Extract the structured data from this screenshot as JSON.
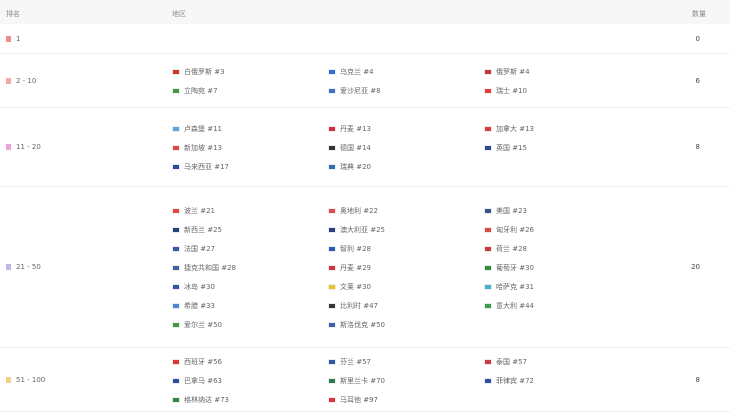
{
  "header": {
    "rank_label": "排名",
    "country_label": "地区",
    "count_label": "数量"
  },
  "groups": [
    {
      "range": "1",
      "color": "#f48b8b",
      "count": "0",
      "countries": []
    },
    {
      "range": "2 - 10",
      "color": "#f6a8a8",
      "count": "6",
      "countries": [
        {
          "name": "白俄罗斯 #3",
          "flag": "#d22f27"
        },
        {
          "name": "乌克兰 #4",
          "flag": "#2f6fd4"
        },
        {
          "name": "俄罗斯 #4",
          "flag": "#c8353d"
        },
        {
          "name": "立陶宛 #7",
          "flag": "#3a9b46"
        },
        {
          "name": "爱沙尼亚 #8",
          "flag": "#3b70c4"
        },
        {
          "name": "瑞士 #10",
          "flag": "#e23d3d"
        }
      ]
    },
    {
      "range": "11 - 20",
      "color": "#f2a2d8",
      "count": "8",
      "countries": [
        {
          "name": "卢森堡 #11",
          "flag": "#5ba4e0"
        },
        {
          "name": "丹麦 #13",
          "flag": "#d0313c"
        },
        {
          "name": "加拿大 #13",
          "flag": "#dc3b3b"
        },
        {
          "name": "新加坡 #13",
          "flag": "#e04848"
        },
        {
          "name": "德国 #14",
          "flag": "#333333"
        },
        {
          "name": "英国 #15",
          "flag": "#2e4a8c"
        },
        {
          "name": "马来西亚 #17",
          "flag": "#274c9e"
        },
        {
          "name": "瑞典 #20",
          "flag": "#2f6db5"
        }
      ]
    },
    {
      "range": "21 - 50",
      "color": "#c4b4ec",
      "count": "20",
      "countries": [
        {
          "name": "波兰 #21",
          "flag": "#e34848"
        },
        {
          "name": "奥地利 #22",
          "flag": "#e14a4a"
        },
        {
          "name": "美国 #23",
          "flag": "#3a4f8e"
        },
        {
          "name": "新西兰 #25",
          "flag": "#28407e"
        },
        {
          "name": "澳大利亚 #25",
          "flag": "#263f82"
        },
        {
          "name": "匈牙利 #26",
          "flag": "#d8493e"
        },
        {
          "name": "法国 #27",
          "flag": "#3459a8"
        },
        {
          "name": "智利 #28",
          "flag": "#2f57b5"
        },
        {
          "name": "荷兰 #28",
          "flag": "#c8383d"
        },
        {
          "name": "捷克共和国 #28",
          "flag": "#3b61a8"
        },
        {
          "name": "丹麦 #29",
          "flag": "#d0313c"
        },
        {
          "name": "葡萄牙 #30",
          "flag": "#2f8a3a"
        },
        {
          "name": "冰岛 #30",
          "flag": "#2c55a8"
        },
        {
          "name": "文莱 #30",
          "flag": "#e9c32d"
        },
        {
          "name": "哈萨克 #31",
          "flag": "#41b3c8"
        },
        {
          "name": "希腊 #33",
          "flag": "#4c86d0"
        },
        {
          "name": "比利时 #47",
          "flag": "#333333"
        },
        {
          "name": "意大利 #44",
          "flag": "#3b9c4c"
        },
        {
          "name": "爱尔兰 #50",
          "flag": "#3a9b46"
        },
        {
          "name": "斯洛伐克 #50",
          "flag": "#3b5ea8"
        }
      ]
    },
    {
      "range": "51 - 100",
      "color": "#f6cf86",
      "count": "8",
      "countries": [
        {
          "name": "西班牙 #56",
          "flag": "#d9382d"
        },
        {
          "name": "芬兰 #57",
          "flag": "#2f59a5"
        },
        {
          "name": "泰国 #57",
          "flag": "#cc3b44"
        },
        {
          "name": "巴拿马 #63",
          "flag": "#2c50a0"
        },
        {
          "name": "斯里兰卡 #70",
          "flag": "#2a7c4b"
        },
        {
          "name": "菲律宾 #72",
          "flag": "#2e4fa3"
        },
        {
          "name": "格林纳达 #73",
          "flag": "#2f8a45"
        },
        {
          "name": "马耳他 #97",
          "flag": "#d8383d"
        }
      ]
    }
  ]
}
